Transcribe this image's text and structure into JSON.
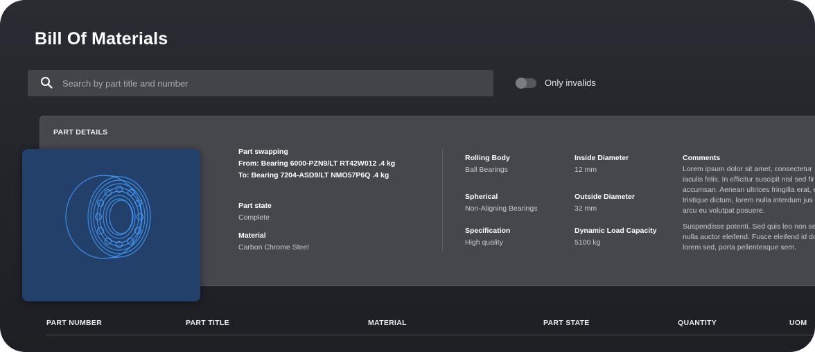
{
  "page": {
    "title": "Bill Of Materials"
  },
  "search": {
    "placeholder": "Search by part title and number",
    "value": ""
  },
  "filter": {
    "only_invalids_label": "Only invalids",
    "only_invalids_on": false
  },
  "part_details": {
    "heading": "PART DETAILS",
    "image": {
      "icon": "bearing-wireframe-icon",
      "background": "#23406b",
      "stroke": "#3c8ee8"
    },
    "part_swapping": {
      "label": "Part swapping",
      "from": "From: Bearing 6000-PZN9/LT RT42W012 .4 kg",
      "to": "To: Bearing 7204-ASD9/LT NMO57P6Q .4 kg"
    },
    "part_state": {
      "label": "Part state",
      "value": "Complete"
    },
    "material": {
      "label": "Material",
      "value": "Carbon Chrome Steel"
    },
    "rolling_body": {
      "label": "Rolling Body",
      "value": "Ball Bearings"
    },
    "inside_diameter": {
      "label": "Inside Diameter",
      "value": "12 mm"
    },
    "spherical": {
      "label": "Spherical",
      "value": "Non-Aligning Bearings"
    },
    "outside_diameter": {
      "label": "Outside Diameter",
      "value": "32 mm"
    },
    "specification": {
      "label": "Specification",
      "value": "High quality"
    },
    "dynamic_load_capacity": {
      "label": "Dynamic Load Capacity",
      "value": "5100 kg"
    },
    "comments": {
      "label": "Comments",
      "lines": [
        "Lorem ipsum dolor sit amet, consectetur",
        "iaculis felis. In efficitur suscipit nisl sed fir",
        "accumsan. Aenean ultrices fringilla erat, e",
        "tristique dictum, lorem nulla interdum jus",
        "arcu eu volutpat posuere.",
        "Suspendisse potenti. Sed quis leo non se",
        "nulla auctor eleifend. Fusce eleifend id do",
        "lorem sed, porta pellentesque sem."
      ]
    }
  },
  "table": {
    "columns": [
      "PART NUMBER",
      "PART TITLE",
      "MATERIAL",
      "PART STATE",
      "QUANTITY",
      "UOM"
    ]
  },
  "colors": {
    "background": "#25272d",
    "panel": "#45474c",
    "accent": "#3c8ee8"
  }
}
